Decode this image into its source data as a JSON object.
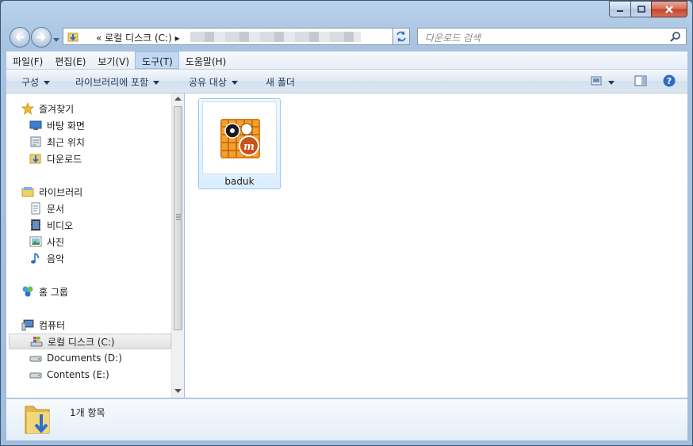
{
  "address_bar": {
    "path": "« 로컬 디스크 (C:) ▸"
  },
  "search": {
    "placeholder": "다운로드 검색"
  },
  "menu": [
    "파일(F)",
    "편집(E)",
    "보기(V)",
    "도구(T)",
    "도움말(H)"
  ],
  "toolbar": {
    "organize": "구성",
    "include_library": "라이브러리에 포함",
    "share": "공유 대상",
    "new_folder": "새 폴더"
  },
  "nav": {
    "favorites": "즐겨찾기",
    "desktop": "바탕 화면",
    "recent": "최근 위치",
    "downloads": "다운로드",
    "libraries": "라이브러리",
    "documents": "문서",
    "videos": "비디오",
    "pictures": "사진",
    "music": "음악",
    "homegroup": "홈 그룹",
    "computer": "컴퓨터",
    "drive_c": "로컬 디스크 (C:)",
    "drive_d": "Documents (D:)",
    "drive_e": "Contents (E:)"
  },
  "files": [
    {
      "name": "baduk",
      "icon": "baduk-app-icon"
    }
  ],
  "details": {
    "count": "1개 항목"
  }
}
